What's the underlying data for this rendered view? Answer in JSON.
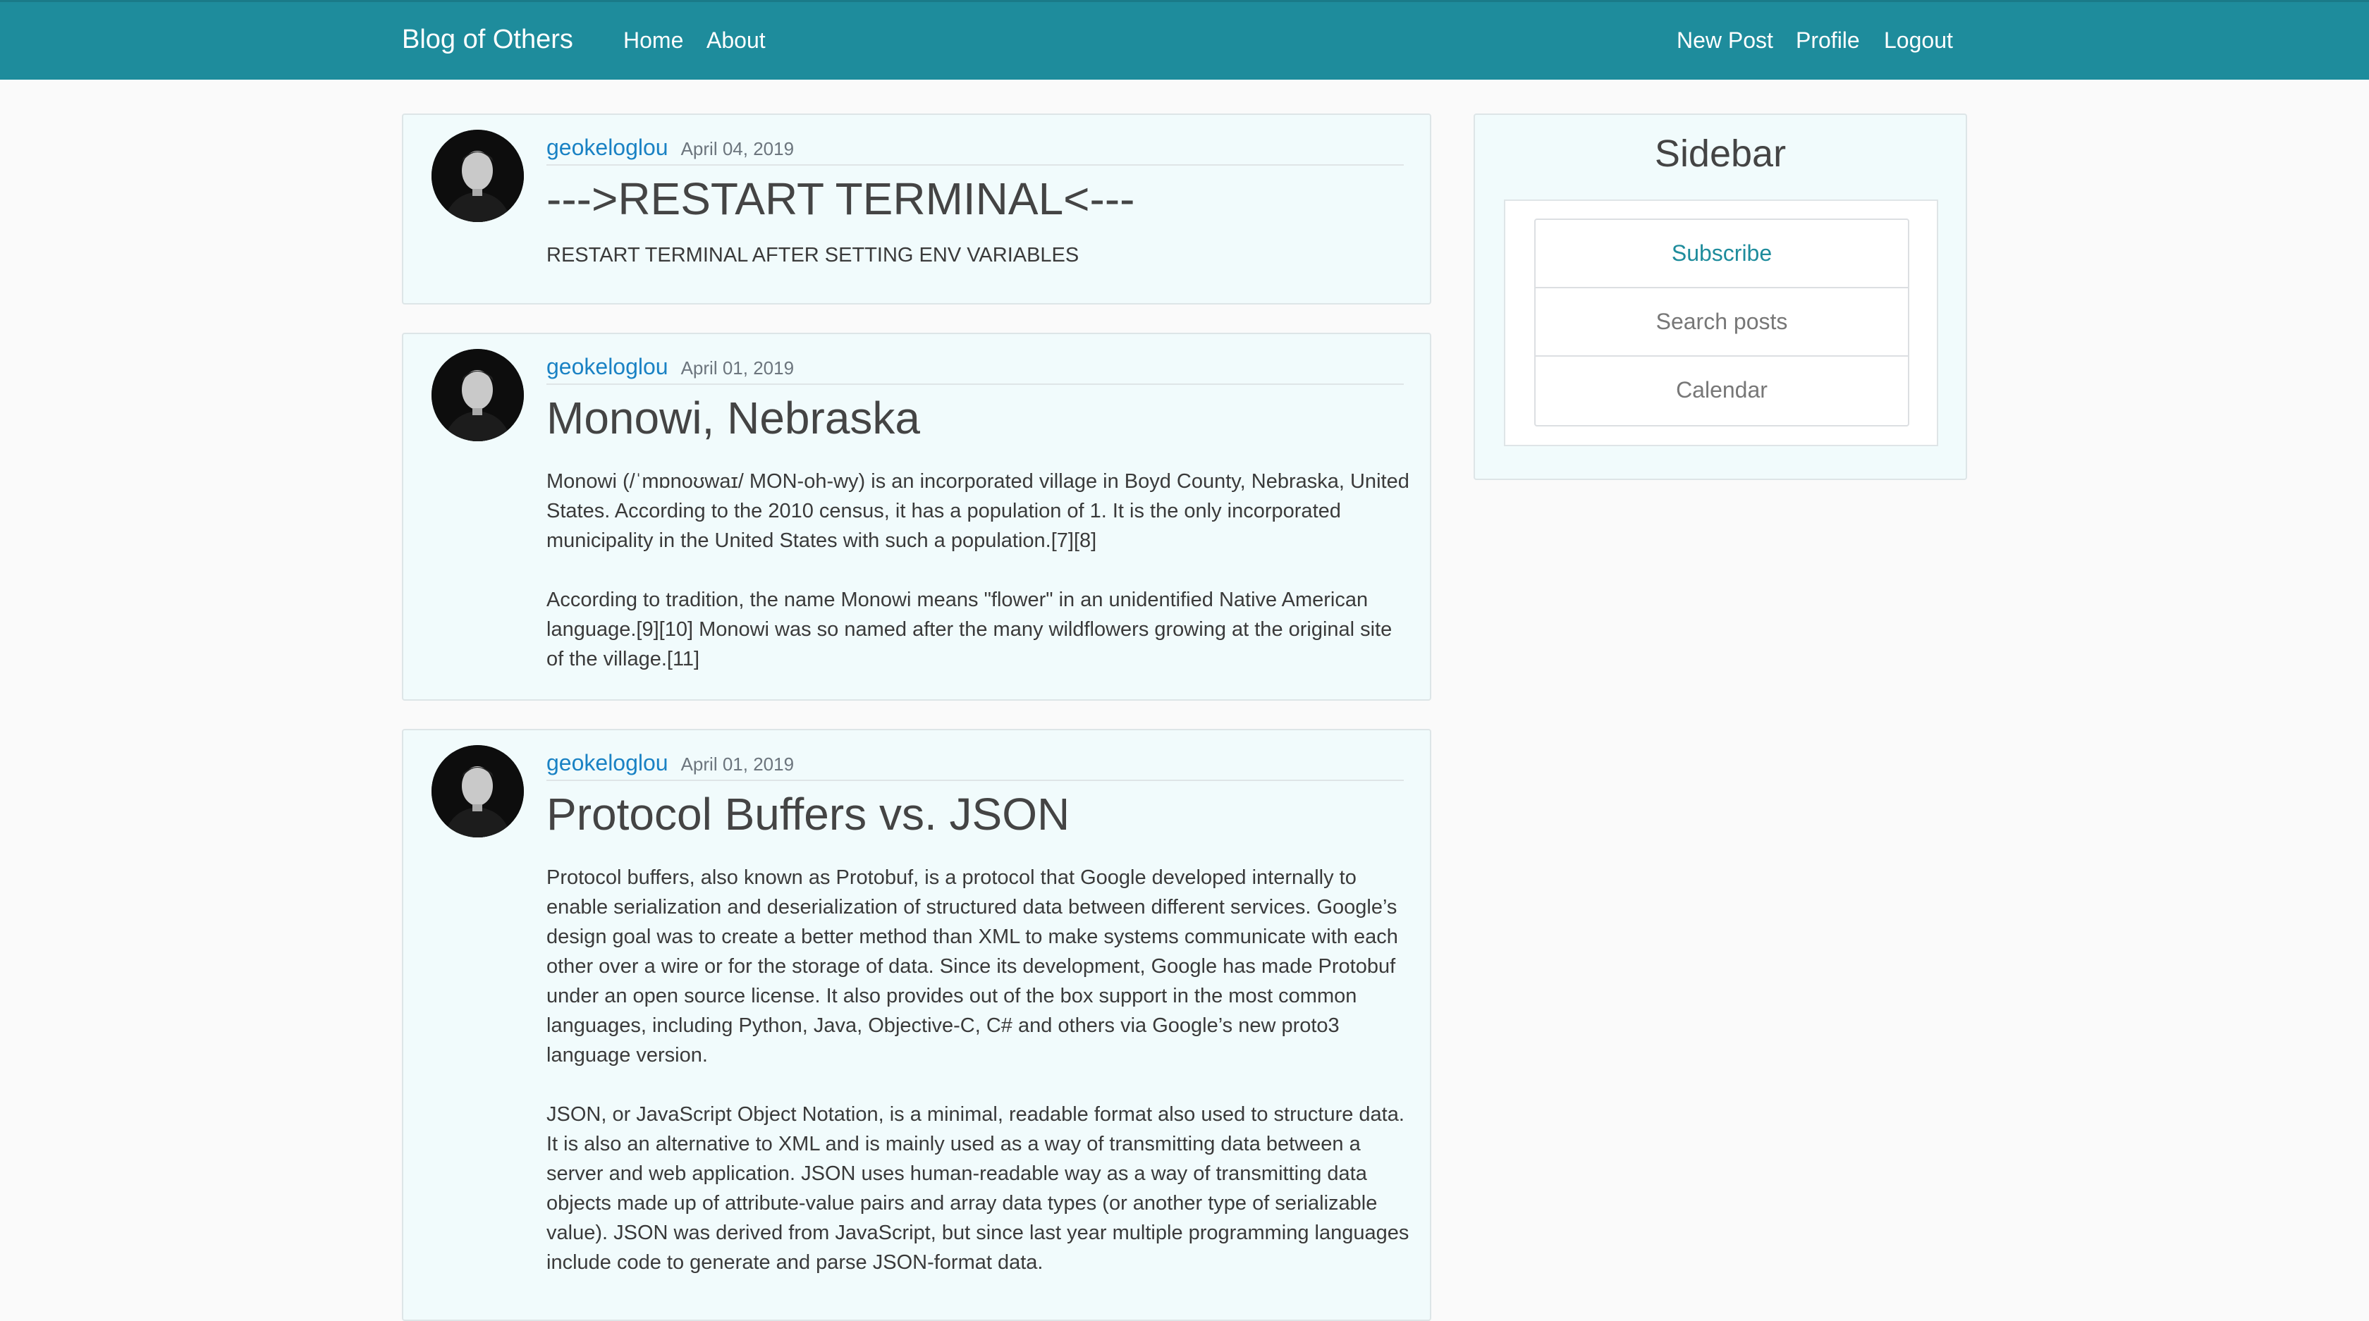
{
  "colors": {
    "navbar": "#1e8c9c",
    "card_background": "#f1fbfc",
    "author_link": "#1a82c4",
    "accent": "#1e8c9c"
  },
  "navbar": {
    "brand": "Blog of Others",
    "left_links": [
      "Home",
      "About"
    ],
    "right_links": [
      "New Post",
      "Profile",
      "Logout"
    ]
  },
  "posts": [
    {
      "author": "geokeloglou",
      "date": "April 04, 2019",
      "title": "--->RESTART TERMINAL<---",
      "paragraphs": [
        "RESTART TERMINAL AFTER SETTING ENV VARIABLES"
      ]
    },
    {
      "author": "geokeloglou",
      "date": "April 01, 2019",
      "title": "Monowi, Nebraska",
      "paragraphs": [
        "Monowi (/ˈmɒnoʊwaɪ/ MON-oh-wy) is an incorporated village in Boyd County, Nebraska, United States. According to the 2010 census, it has a population of 1. It is the only incorporated municipality in the United States with such a population.[7][8]",
        "According to tradition, the name Monowi means \"flower\" in an unidentified Native American language.[9][10] Monowi was so named after the many wildflowers growing at the original site of the village.[11]"
      ]
    },
    {
      "author": "geokeloglou",
      "date": "April 01, 2019",
      "title": "Protocol Buffers vs. JSON",
      "paragraphs": [
        "Protocol buffers, also known as Protobuf, is a protocol that Google developed internally to enable serialization and deserialization of structured data between different services. Google’s design goal was to create a better method than XML to make systems communicate with each other over a wire or for the storage of data. Since its development, Google has made Protobuf under an open source license. It also provides out of the box support in the most common languages, including Python, Java, Objective-C, C# and others via Google’s new proto3 language version.",
        "JSON, or JavaScript Object Notation, is a minimal, readable format also used to structure data. It is also an alternative to XML and is mainly used as a way of transmitting data between a server and web application. JSON uses human-readable way as a way of transmitting data objects made up of attribute-value pairs and array data types (or another type of serializable value). JSON was derived from JavaScript, but since last year multiple programming languages include code to generate and parse JSON-format data."
      ]
    }
  ],
  "sidebar": {
    "title": "Sidebar",
    "items": [
      "Subscribe",
      "Search posts",
      "Calendar"
    ]
  }
}
